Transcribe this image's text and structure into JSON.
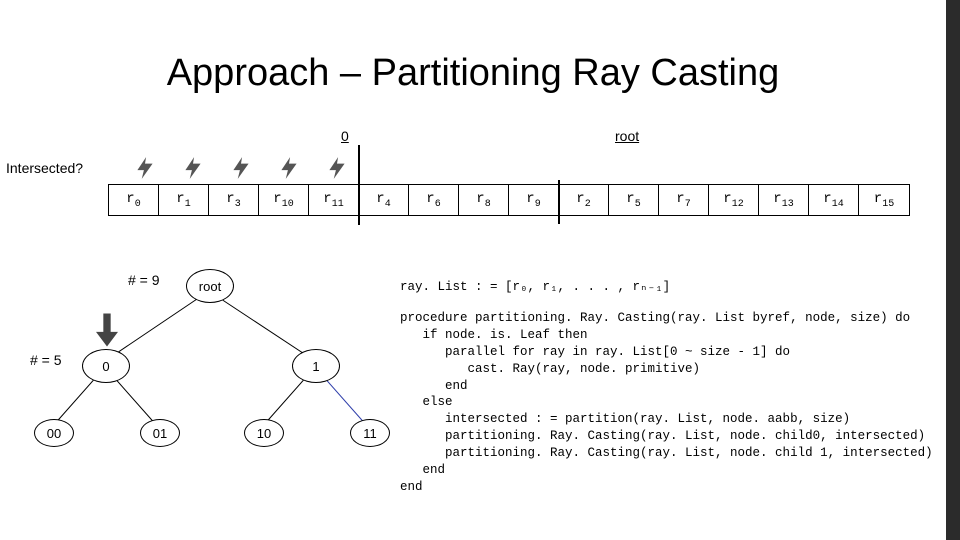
{
  "title": "Approach – Partitioning Ray Casting",
  "labels": {
    "zero": "0",
    "root": "root",
    "intersected": "Intersected?",
    "hash9": "# = 9",
    "hash5": "# = 5"
  },
  "rays": [
    "r0",
    "r1",
    "r3",
    "r10",
    "r11",
    "r4",
    "r6",
    "r8",
    "r9",
    "r2",
    "r5",
    "r7",
    "r12",
    "r13",
    "r14",
    "r15"
  ],
  "tree": {
    "root": "root",
    "n0": "0",
    "n1": "1",
    "n00": "00",
    "n01": "01",
    "n10": "10",
    "n11": "11"
  },
  "code": {
    "raylist_def": "ray. List : = [r₀, r₁, . . . , rₙ₋₁]",
    "proc": "procedure partitioning. Ray. Casting(ray. List byref, node, size) do\n   if node. is. Leaf then\n      parallel for ray in ray. List[0 ~ size - 1] do\n         cast. Ray(ray, node. primitive)\n      end\n   else\n      intersected : = partition(ray. List, node. aabb, size)\n      partitioning. Ray. Casting(ray. List, node. child0, intersected)\n      partitioning. Ray. Casting(ray. List, node. child 1, intersected)\n   end\nend"
  }
}
